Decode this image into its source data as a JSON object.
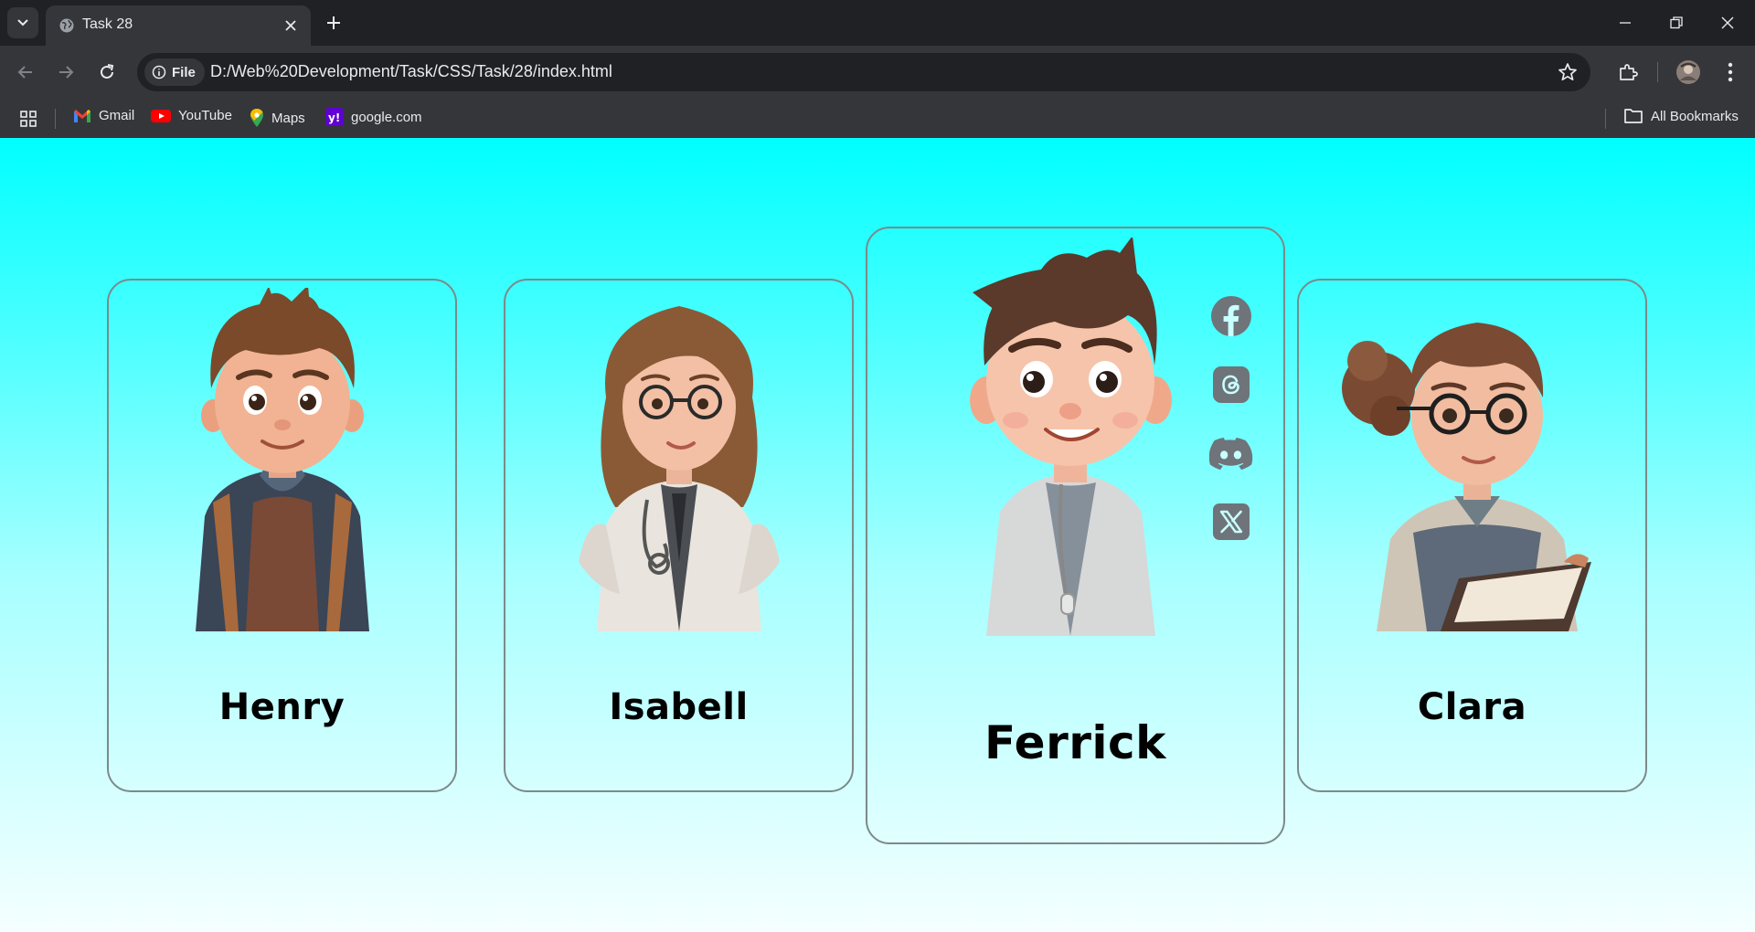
{
  "browser": {
    "tab_title": "Task 28",
    "url": "D:/Web%20Development/Task/CSS/Task/28/index.html",
    "security_chip": "File",
    "bookmarks": [
      {
        "label": "Gmail",
        "icon": "gmail-icon"
      },
      {
        "label": "YouTube",
        "icon": "youtube-icon"
      },
      {
        "label": "Maps",
        "icon": "maps-icon"
      },
      {
        "label": "google.com",
        "icon": "yahoo-icon"
      }
    ],
    "all_bookmarks": "All Bookmarks"
  },
  "page": {
    "background_top": "#00ffff",
    "background_bottom": "#f5ffff",
    "cards": [
      {
        "name": "Henry",
        "avatar": "boy-with-backpack-avatar"
      },
      {
        "name": "Isabell",
        "avatar": "girl-doctor-avatar"
      },
      {
        "name": "Ferrick",
        "avatar": "boy-doctor-avatar",
        "active": true,
        "socials": [
          "facebook-icon",
          "threads-icon",
          "discord-icon",
          "x-icon"
        ]
      },
      {
        "name": "Clara",
        "avatar": "girl-with-book-avatar"
      }
    ],
    "social_icon_color": "#6e7479"
  }
}
